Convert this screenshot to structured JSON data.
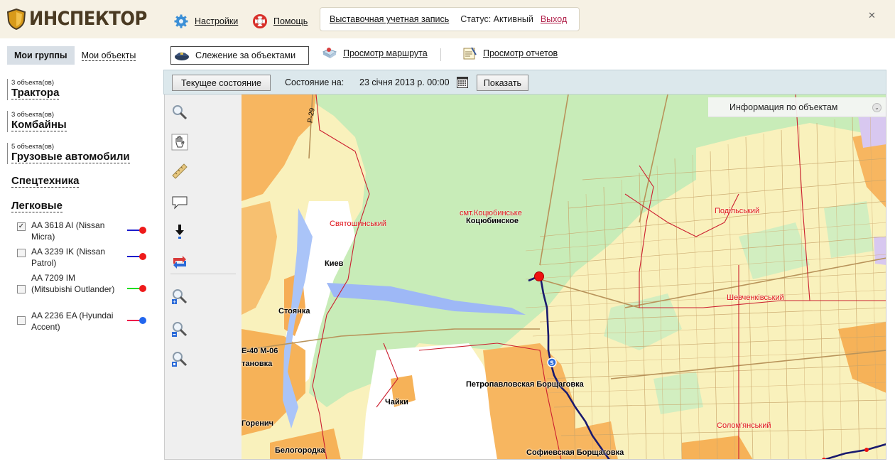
{
  "header": {
    "logo_text": "ИНСПЕКТОР",
    "settings_label": "Настройки",
    "help_label": "Помощь",
    "account_label": "Выставочная учетная запись",
    "status_text": "Статус: Активный",
    "logout_label": "Выход",
    "close_glyph": "✕"
  },
  "sidebar": {
    "tabs": [
      {
        "label": "Мои группы",
        "active": true
      },
      {
        "label": "Мои объекты",
        "active": false
      }
    ],
    "groups": [
      {
        "count": "3 объекта(ов)",
        "name": "Трактора"
      },
      {
        "count": "3 объекта(ов)",
        "name": "Комбайны"
      },
      {
        "count": "5 объекта(ов)",
        "name": "Грузовые автомобили"
      },
      {
        "count": "",
        "name": "Спецтехника"
      },
      {
        "count": "",
        "name": "Легковые"
      }
    ],
    "objects": [
      {
        "name": "AA 3618 AI (Nissan Micra)",
        "checked": true,
        "line_color": "#1c1ccc",
        "dot_color": "#ee1a1a"
      },
      {
        "name": "AA 3239 IK (Nissan Patrol)",
        "checked": false,
        "line_color": "#1c1ccc",
        "dot_color": "#ee1a1a"
      },
      {
        "name": "AA 7209 IM (Mitsubishi Outlander)",
        "checked": false,
        "line_color": "#22dd22",
        "dot_color": "#ee1a1a"
      },
      {
        "name": "AA 2236 EA (Hyundai Accent)",
        "checked": false,
        "line_color": "#ee1a4a",
        "dot_color": "#2266ee"
      }
    ]
  },
  "nav": {
    "tracking_label": "Слежение за объектами",
    "route_label": "Просмотр маршрута",
    "reports_label": "Просмотр отчетов"
  },
  "statusbar": {
    "current_button": "Текущее состояние",
    "state_label": "Состояние на:",
    "date_value": "23 січня 2013 р. 00:00",
    "show_button": "Показать"
  },
  "map": {
    "info_panel_title": "Информация по объектам",
    "labels": [
      {
        "text": "смт.Коцюбинське",
        "style": "red"
      },
      {
        "text": "Коцюбинское",
        "style": "black"
      },
      {
        "text": "Подільський",
        "style": "red"
      },
      {
        "text": "Святошинський",
        "style": "red"
      },
      {
        "text": "Киев",
        "style": "black"
      },
      {
        "text": "Шевченківський",
        "style": "red"
      },
      {
        "text": "Стоянка",
        "style": "black"
      },
      {
        "text": "Е-40 М-06",
        "style": "black"
      },
      {
        "text": "Петропавловская Борщаговка",
        "style": "black"
      },
      {
        "text": "Чайки",
        "style": "black"
      },
      {
        "text": "Горенич",
        "style": "black"
      },
      {
        "text": "Белогородка",
        "style": "black"
      },
      {
        "text": "Софиевская Борщаговка",
        "style": "black"
      },
      {
        "text": "Солом'янський",
        "style": "red"
      },
      {
        "text": "Р-29",
        "style": "road"
      },
      {
        "text": "тановка",
        "style": "black"
      }
    ],
    "route_color": "#1a1a6e",
    "vehicle_color": "#ee1111",
    "stop_marker": "S"
  },
  "tools": [
    "zoom-select-tool-icon",
    "pan-hand-icon",
    "ruler-icon",
    "comment-bubble-icon",
    "pin-down-icon",
    "refresh-swap-icon",
    "zoom-in-icon",
    "zoom-out-icon",
    "zoom-fit-icon"
  ]
}
